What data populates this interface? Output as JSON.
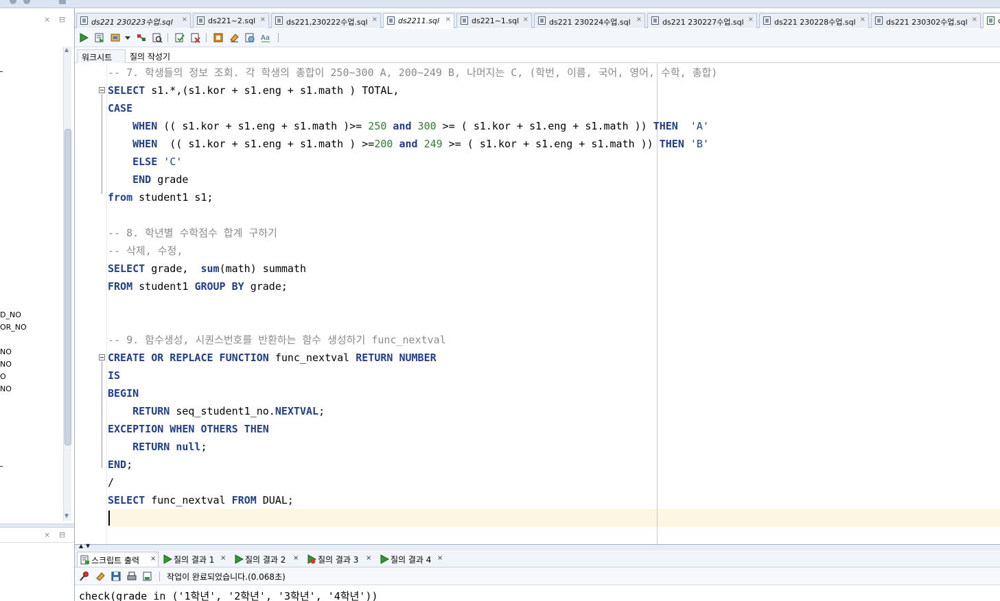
{
  "left_panel": {
    "close_glyph": "×",
    "minimize_glyph": "⊟",
    "items": [
      "D_NO",
      "OR_NO",
      "NO",
      "NO",
      "O",
      "NO"
    ],
    "scroll_up": "▲",
    "scroll_down": "▼"
  },
  "tabs": [
    {
      "label": "ds221 230223수업.sql",
      "close": "×",
      "italic": true
    },
    {
      "label": "ds221~2.sql",
      "close": "×",
      "italic": false
    },
    {
      "label": "ds221,230222수업.sql",
      "close": "×",
      "italic": false
    },
    {
      "label": "ds2211.sql",
      "close": "×",
      "italic": true
    },
    {
      "label": "ds221~1.sql",
      "close": "×",
      "italic": false
    },
    {
      "label": "ds221 230224수업.sql",
      "close": "×",
      "italic": false
    },
    {
      "label": "ds221 230227수업.sql",
      "close": "×",
      "italic": false
    },
    {
      "label": "ds221 230228수업.sql",
      "close": "×",
      "italic": false
    },
    {
      "label": "ds221 230302수업.sql",
      "close": "×",
      "italic": false
    },
    {
      "label": "d",
      "close": "",
      "italic": false
    }
  ],
  "subtabs": {
    "worksheet": "워크시트",
    "query_builder": "질의 작성기"
  },
  "code": [
    [
      [
        "cm",
        "-- 7. 학생들의 정보 조회. 각 학생의 총합이 250~300 A, 200~249 B, 나머지는 C, (학번, 이름, 국어, 영어, 수학, 총합)"
      ]
    ],
    [
      [
        "kw",
        "SELECT"
      ],
      [
        "",
        " s1.*,(s1.kor + s1.eng + s1.math ) TOTAL,"
      ]
    ],
    [
      [
        "kw",
        "CASE"
      ]
    ],
    [
      [
        "",
        "    "
      ],
      [
        "kw",
        "WHEN"
      ],
      [
        "",
        " (( s1.kor + s1.eng + s1.math )>= "
      ],
      [
        "nm",
        "250"
      ],
      [
        "",
        " "
      ],
      [
        "kw",
        "and"
      ],
      [
        "",
        " "
      ],
      [
        "nm",
        "300"
      ],
      [
        "",
        " >= ( s1.kor + s1.eng + s1.math )) "
      ],
      [
        "kw",
        "THEN"
      ],
      [
        "",
        "  "
      ],
      [
        "st",
        "'A'"
      ]
    ],
    [
      [
        "",
        "    "
      ],
      [
        "kw",
        "WHEN"
      ],
      [
        "",
        "  (( s1.kor + s1.eng + s1.math ) >="
      ],
      [
        "nm",
        "200"
      ],
      [
        "",
        " "
      ],
      [
        "kw",
        "and"
      ],
      [
        "",
        " "
      ],
      [
        "nm",
        "249"
      ],
      [
        "",
        " >= ( s1.kor + s1.eng + s1.math )) "
      ],
      [
        "kw",
        "THEN"
      ],
      [
        "",
        " "
      ],
      [
        "st",
        "'B'"
      ]
    ],
    [
      [
        "",
        "    "
      ],
      [
        "kw",
        "ELSE"
      ],
      [
        "",
        " "
      ],
      [
        "st",
        "'C'"
      ]
    ],
    [
      [
        "",
        "    "
      ],
      [
        "kw",
        "END"
      ],
      [
        "",
        " grade"
      ]
    ],
    [
      [
        "kw",
        "from"
      ],
      [
        "",
        " student1 s1;"
      ]
    ],
    [
      [
        "",
        ""
      ]
    ],
    [
      [
        "cm",
        "-- 8. 학년별 수학점수 합계 구하기"
      ]
    ],
    [
      [
        "cm",
        "-- 삭제, 수정,"
      ]
    ],
    [
      [
        "kw",
        "SELECT"
      ],
      [
        "",
        " grade,  "
      ],
      [
        "kw",
        "sum"
      ],
      [
        "",
        "(math) summath"
      ]
    ],
    [
      [
        "kw",
        "FROM"
      ],
      [
        "",
        " student1 "
      ],
      [
        "kw",
        "GROUP BY"
      ],
      [
        "",
        " grade;"
      ]
    ],
    [
      [
        "",
        ""
      ]
    ],
    [
      [
        "",
        ""
      ]
    ],
    [
      [
        "cm",
        "-- 9. 함수생성, 시퀀스번호를 반환하는 함수 생성하기 func_nextval"
      ]
    ],
    [
      [
        "kw",
        "CREATE OR REPLACE FUNCTION"
      ],
      [
        "",
        " func_nextval "
      ],
      [
        "kw",
        "RETURN NUMBER"
      ]
    ],
    [
      [
        "kw",
        "IS"
      ]
    ],
    [
      [
        "kw",
        "BEGIN"
      ]
    ],
    [
      [
        "",
        "    "
      ],
      [
        "kw",
        "RETURN"
      ],
      [
        "",
        " seq_student1_no."
      ],
      [
        "kw",
        "NEXTVAL"
      ],
      [
        "",
        ";"
      ]
    ],
    [
      [
        "kw",
        "EXCEPTION WHEN OTHERS THEN"
      ]
    ],
    [
      [
        "",
        "    "
      ],
      [
        "kw",
        "RETURN"
      ],
      [
        "",
        " "
      ],
      [
        "kw",
        "null"
      ],
      [
        "",
        ";"
      ]
    ],
    [
      [
        "kw",
        "END"
      ],
      [
        "",
        ";"
      ]
    ],
    [
      [
        "",
        "/"
      ]
    ],
    [
      [
        "kw",
        "SELECT"
      ],
      [
        "",
        " func_nextval "
      ],
      [
        "kw",
        "FROM"
      ],
      [
        "",
        " DUAL;"
      ]
    ]
  ],
  "output_tabs": [
    {
      "label": "스크립트 출력",
      "close": "×"
    },
    {
      "label": "질의 결과 1",
      "close": "×"
    },
    {
      "label": "질의 결과 2",
      "close": "×"
    },
    {
      "label": "질의 결과 3",
      "close": "×"
    },
    {
      "label": "질의 결과 4",
      "close": "×"
    }
  ],
  "output_status": "작업이 완료되었습니다.(0.068초)",
  "output_text": "check(grade in ('1학년', '2학년', '3학년', '4학년'))",
  "colors": {
    "keyword": "#1f3f8a",
    "comment": "#8a8a8a",
    "number": "#2e7d32",
    "current_line": "#fdf6e3"
  }
}
